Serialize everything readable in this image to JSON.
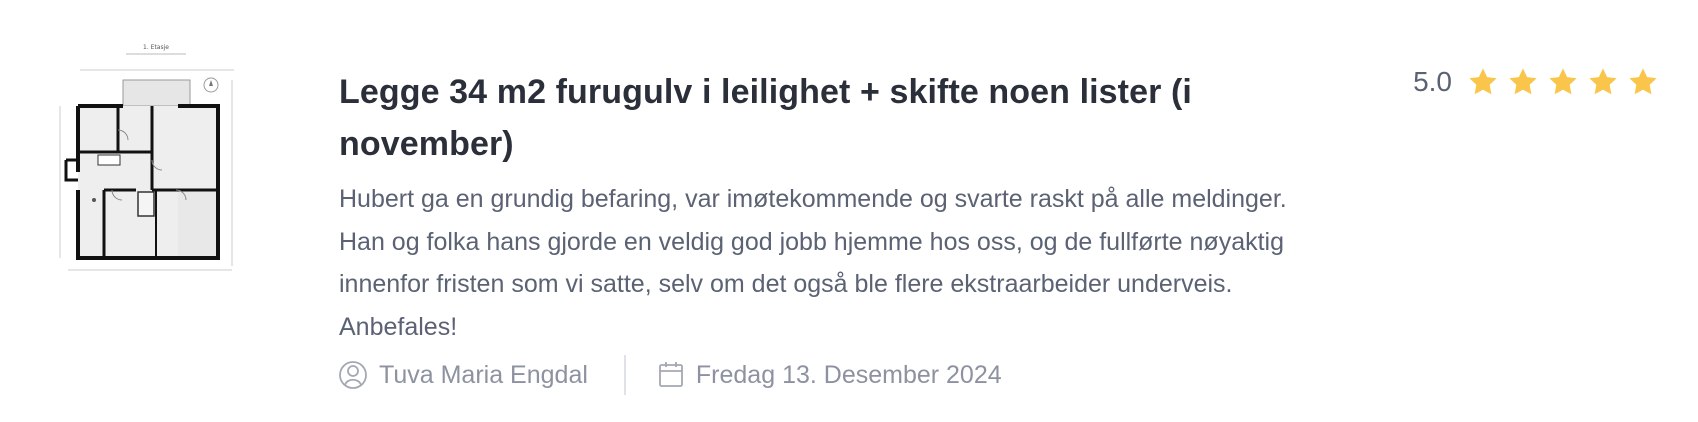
{
  "review": {
    "title": "Legge 34 m2 furugulv i leilighet + skifte noen lister (i november)",
    "body": "Hubert ga en grundig befaring, var imøtekommende og svarte raskt på alle meldinger. Han og folka hans gjorde en veldig god jobb hjemme hos oss, og de fullførte nøyaktig innenfor fristen som vi satte, selv om det også ble flere ekstraarbeider underveis. Anbefales!",
    "rating_value": "5.0",
    "rating": 5,
    "rating_max": 5,
    "author": "Tuva Maria Engdal",
    "date": "Fredag 13. Desember 2024",
    "thumbnail_label": "1. Etasje"
  },
  "icons": {
    "author": "user-icon",
    "date": "calendar-icon",
    "star": "star-icon"
  },
  "colors": {
    "star": "#f9c64b",
    "title": "#2b2f3a",
    "body": "#5b6274",
    "meta": "#8c92a0"
  }
}
